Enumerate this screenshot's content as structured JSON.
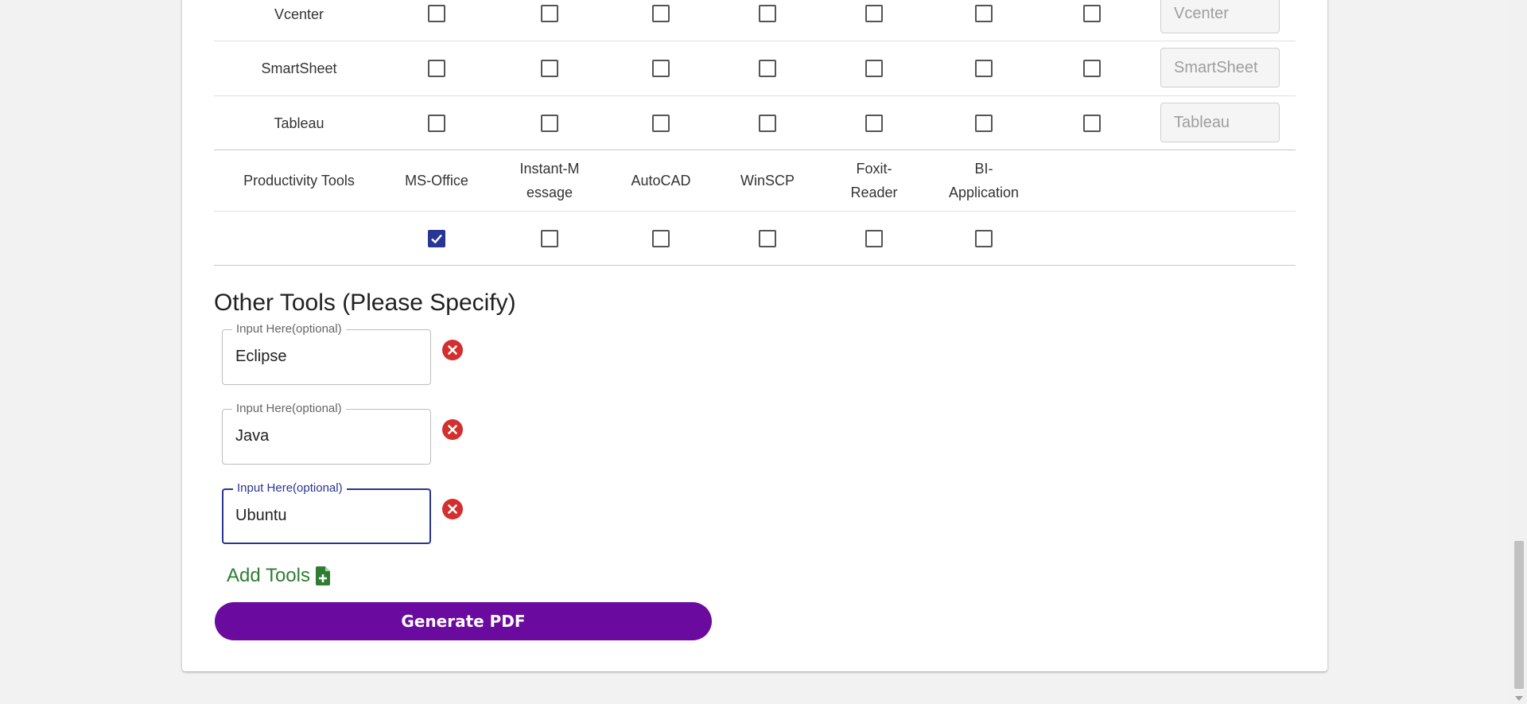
{
  "table": {
    "rows": [
      {
        "name": "Vcenter",
        "placeholder": "Vcenter"
      },
      {
        "name": "SmartSheet",
        "placeholder": "SmartSheet"
      },
      {
        "name": "Tableau",
        "placeholder": "Tableau"
      }
    ],
    "productivity": {
      "section_label": "Productivity Tools",
      "columns": [
        "MS-Office",
        "Instant-Message",
        "AutoCAD",
        "WinSCP",
        "Foxit-Reader",
        "BI-Application"
      ],
      "checked": [
        true,
        false,
        false,
        false,
        false,
        false
      ]
    }
  },
  "other_tools": {
    "title": "Other Tools (Please Specify)",
    "field_label": "Input Here(optional)",
    "fields": [
      "Eclipse",
      "Java",
      "Ubuntu"
    ]
  },
  "actions": {
    "add_tools_label": "Add Tools",
    "generate_pdf_label": "Generate PDF"
  },
  "colors": {
    "accent": "#283593",
    "remove": "#d32f2f",
    "add": "#2e7d32",
    "primary_button": "#6a0a9e"
  }
}
